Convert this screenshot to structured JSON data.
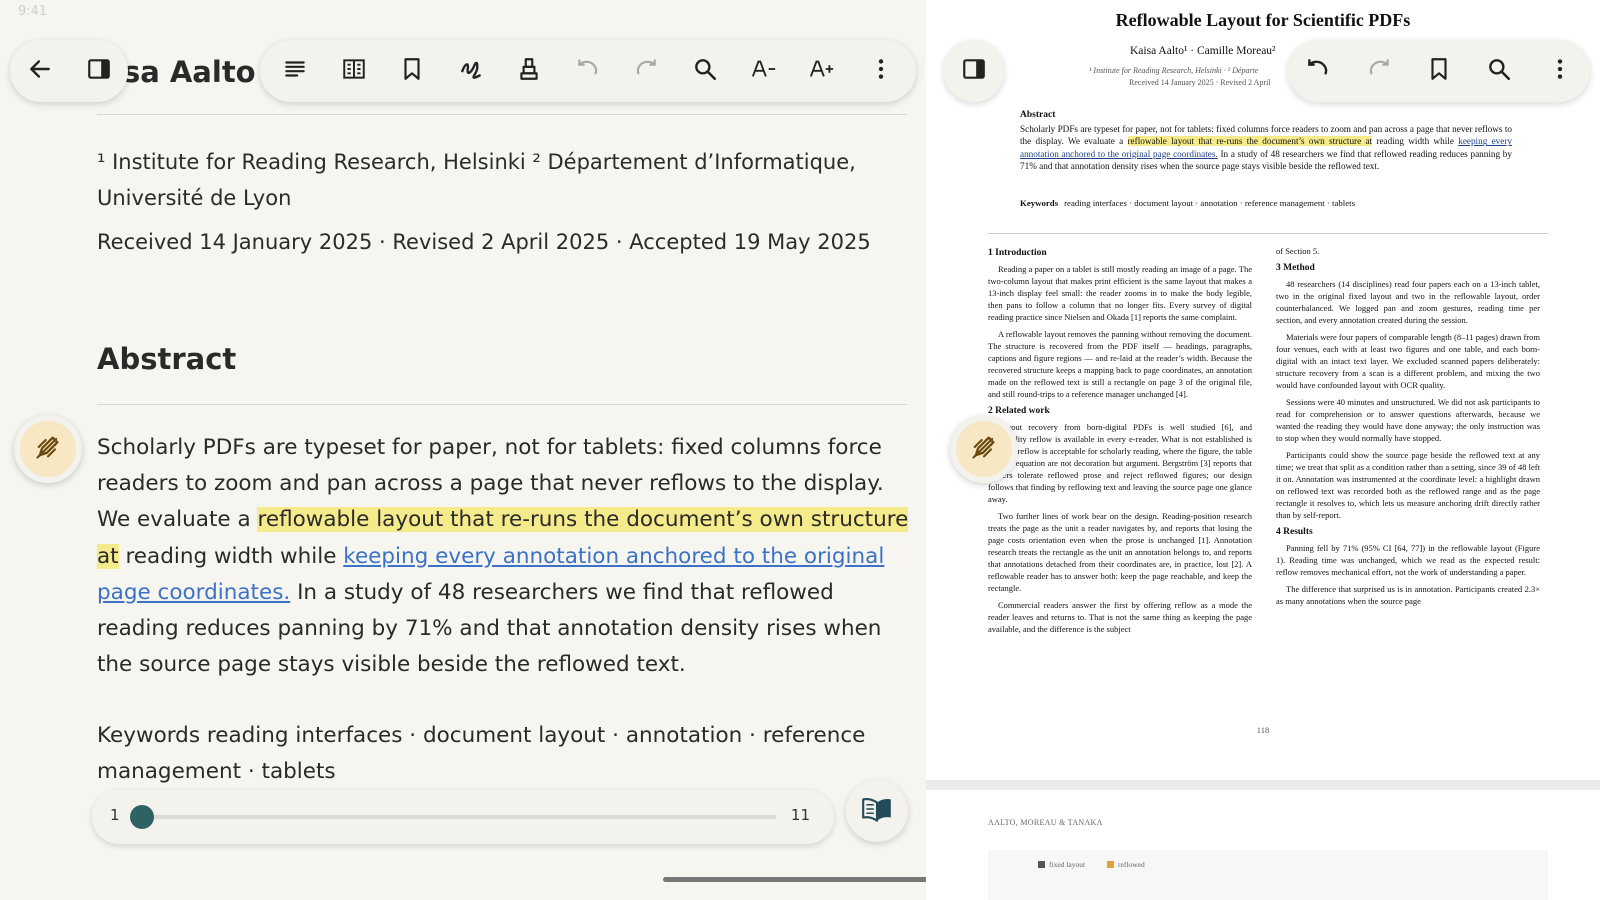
{
  "status": {
    "time": "9:41"
  },
  "reflow": {
    "header_title": "isa Aalto",
    "affiliations": "¹ Institute for Reading Research, Helsinki ² Département d’Informatique, Université de Lyon",
    "received_line": "Received 14 January 2025 · Revised 2 April 2025 · Accepted 19 May 2025",
    "abstract_heading": "Abstract",
    "abstract": {
      "before": "Scholarly PDFs are typeset for paper, not for tablets: fixed columns force readers to zoom and pan across a page that never reflows to the display. We evaluate a ",
      "highlight": "reflowable layout that re-runs the document’s own structure at",
      "middle": " reading width while ",
      "link": "keeping every annotation anchored to the original page coordinates.",
      "after": " In a study of 48 researchers we find that reflowed reading reduces panning by 71% and that annotation density rises when the source page stays visible beside the reflowed text."
    },
    "keywords": "Keywords reading interfaces · document layout · annotation · reference management · tablets",
    "page_slider": {
      "start_label": "1",
      "end_label": "11",
      "current": 1,
      "min": 1,
      "max": 11
    }
  },
  "toolbar_left": {
    "nav": [
      "back-icon",
      "split-view-icon"
    ],
    "tools": [
      "outline-icon",
      "reflow-columns-icon",
      "bookmark-icon",
      "ink-icon",
      "highlighter-icon",
      "undo-icon",
      "redo-icon",
      "search-icon",
      "decrease-font-icon",
      "increase-font-icon",
      "more-icon"
    ]
  },
  "toolbar_right": {
    "tools": [
      "split-view-icon",
      "undo-icon",
      "redo-icon",
      "bookmark-icon",
      "search-icon",
      "more-icon"
    ]
  },
  "pdf": {
    "title": "Reflowable Layout for Scientific PDFs",
    "authors": "Kaisa Aalto¹ · Camille Moreau²",
    "affil": "¹ Institute for Reading Research, Helsinki · ² Départe",
    "dates": "Received 14 January 2025 · Revised 2 April",
    "abstract_heading": "Abstract",
    "abstract": {
      "before": "Scholarly PDFs are typeset for paper, not for tablets: fixed columns force readers to zoom and pan across a page that never reflows to the display. We evaluate a ",
      "highlight": "reflowable layout that re-runs the document’s own structure at",
      "middle": " reading width while ",
      "link": "keeping every annotation anchored to the original page coordinates.",
      "after": " In a study of 48 researchers we find that reflowed reading reduces panning by 71% and that annotation density rises when the source page stays visible beside the reflowed text."
    },
    "keywords_label": "Keywords",
    "keywords": "reading interfaces · document layout · annotation · reference management · tablets",
    "col_left": {
      "intro_heading": "1  Introduction",
      "intro_p1": "Reading a paper on a tablet is still mostly reading an image of a page. The two-column layout that makes print efficient is the same layout that makes a 13-inch display feel small: the reader zooms in to make the body legible, then pans to follow a column that no longer fits. Every survey of digital reading practice since Nielsen and Okada [1] reports the same complaint.",
      "intro_p2": "A reflowable layout removes the panning without removing the document. The structure is recovered from the PDF itself — headings, paragraphs, captions and figure regions — and re-laid at the reader’s width. Because the recovered structure keeps a mapping back to page coordinates, an annotation made on the reflowed text is still a rectangle on page 3 of the original file, and still round-trips to a reference manager unchanged [4].",
      "related_heading": "2  Related work",
      "related_p1": "Layout recovery from born-digital PDFs is well studied [6], and commodity reflow is available in every e-reader. What is not established is whether reflow is acceptable for scholarly reading, where the figure, the table and the equation are not decoration but argument. Bergström [3] reports that readers tolerate reflowed prose and reject reflowed figures; our design follows that finding by reflowing text and leaving the source page one glance away.",
      "related_p2": "Two further lines of work bear on the design. Reading-position research treats the page as the unit a reader navigates by, and reports that losing the page costs orientation even when the prose is unchanged [1]. Annotation research treats the rectangle as the unit an annotation belongs to, and reports that annotations detached from their coordinates are, in practice, lost [2]. A reflowable reader has to answer both: keep the page reachable, and keep the rectangle.",
      "related_p3": "Commercial readers answer the first by offering reflow as a mode the reader leaves and returns to. That is not the same thing as keeping the page available, and the difference is the subject"
    },
    "col_right": {
      "cont": "of Section 5.",
      "method_heading": "3  Method",
      "method_p1": "48 researchers (14 disciplines) read four papers each on a 13-inch tablet, two in the original fixed layout and two in the reflowable layout, order counterbalanced. We logged pan and zoom gestures, reading time per section, and every annotation created during the session.",
      "method_p2": "Materials were four papers of comparable length (8–11 pages) drawn from four venues, each with at least two figures and one table, and each born-digital with an intact text layer. We excluded scanned papers deliberately: structure recovery from a scan is a different problem, and mixing the two would have confounded layout with OCR quality.",
      "method_p3": "Sessions were 40 minutes and unstructured. We did not ask participants to read for comprehension or to answer questions afterwards, because we wanted the reading they would have done anyway; the only instruction was to stop when they would normally have stopped.",
      "method_p4": "Participants could show the source page beside the reflowed text at any time; we treat that split as a condition rather than a setting, since 39 of 48 left it on. Annotation was instrumented at the coordinate level: a highlight drawn on reflowed text was recorded both as the reflowed range and as the page rectangle it resolves to, which lets us measure anchoring drift directly rather than by self-report.",
      "results_heading": "4  Results",
      "results_p1": "Panning fell by 71% (95% CI [64, 77]) in the reflowable layout (Figure 1). Reading time was unchanged, which we read as the expected result: reflow removes mechanical effort, not the work of understanding a paper.",
      "results_p2": "The difference that surprised us is in annotation. Participants created 2.3× as many annotations when the source page"
    },
    "page_number": "118",
    "page2_running_head": "AALTO, MOREAU & TANAKA",
    "page2_legend": [
      "fixed layout",
      "reflowed"
    ]
  },
  "colors": {
    "accent": "#2e6264",
    "highlight": "#f6eb8a",
    "link": "#3b72c8",
    "legend_fixed": "#555555",
    "legend_reflowed": "#e0a33a"
  }
}
